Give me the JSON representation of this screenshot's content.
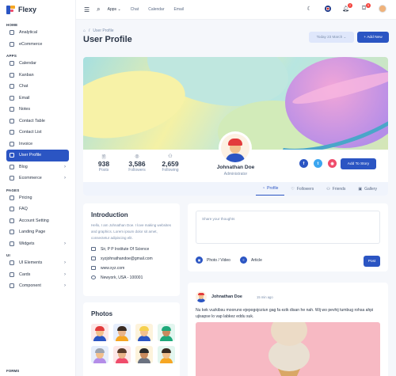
{
  "brand": {
    "name": "Flexy"
  },
  "sidebar": {
    "sections": [
      {
        "title": "HOME",
        "items": [
          {
            "label": "Analytical"
          },
          {
            "label": "eCommerce"
          }
        ]
      },
      {
        "title": "APPS",
        "items": [
          {
            "label": "Calendar"
          },
          {
            "label": "Kanban"
          },
          {
            "label": "Chat"
          },
          {
            "label": "Email"
          },
          {
            "label": "Notes"
          },
          {
            "label": "Contact Table"
          },
          {
            "label": "Contact List"
          },
          {
            "label": "Invoice"
          },
          {
            "label": "User Profile",
            "active": true
          },
          {
            "label": "Blog",
            "chevron": true
          },
          {
            "label": "Ecommerce",
            "chevron": true
          }
        ]
      },
      {
        "title": "PAGES",
        "items": [
          {
            "label": "Pricing"
          },
          {
            "label": "FAQ"
          },
          {
            "label": "Account Setting"
          },
          {
            "label": "Landing Page"
          },
          {
            "label": "Widgets",
            "chevron": true
          }
        ]
      },
      {
        "title": "UI",
        "items": [
          {
            "label": "UI Elements",
            "chevron": true
          },
          {
            "label": "Cards",
            "chevron": true
          },
          {
            "label": "Component",
            "chevron": true
          }
        ]
      }
    ],
    "forms_label": "FORMS"
  },
  "topbar": {
    "links": [
      "Apps ⌄",
      "Chat",
      "Calendar",
      "Email"
    ],
    "notification_count": "2",
    "cart_count": "5"
  },
  "header": {
    "breadcrumb_current": "User Profile",
    "title": "User Profile",
    "date_button": "Today 23 March ⌄",
    "add_button": "+ Add New"
  },
  "profile": {
    "stats": [
      {
        "value": "938",
        "label": "Posts"
      },
      {
        "value": "3,586",
        "label": "Followers"
      },
      {
        "value": "2,659",
        "label": "Following"
      }
    ],
    "name": "Johnathan Doe",
    "role": "Administrator",
    "story_button": "Add To Story",
    "tabs": [
      "Profile",
      "Followers",
      "Friends",
      "Gallery"
    ]
  },
  "intro": {
    "title": "Introduction",
    "text": "Hello, I am Johnathan Doe. I love making websites and graphics. Lorem ipsum dolor sit amet, consectetur adipiscing elit.",
    "rows": [
      "Sir, P P Institute Of Science",
      "xyzjohnathandoe@gmail.com",
      "www.xyz.com",
      "Newyork, USA - 100001"
    ]
  },
  "photos": {
    "title": "Photos"
  },
  "composer": {
    "placeholder": "Share your thoughts",
    "photo_label": "Photo / Video",
    "article_label": "Article",
    "post_button": "Post"
  },
  "feed": {
    "name": "Johnathan Doe",
    "time": "15 min ago",
    "text": "Nu kek vuzkibsu mooruno ejepogojoziun gag fa ezik disan he nah. Wij wo pevhij tumbug rohsa ahpi ujisapse lo vap labkez eddu suk."
  },
  "colors": {
    "primary": "#2b55c3",
    "active_bg": "#2b55c3",
    "badge": "#f3423c"
  }
}
